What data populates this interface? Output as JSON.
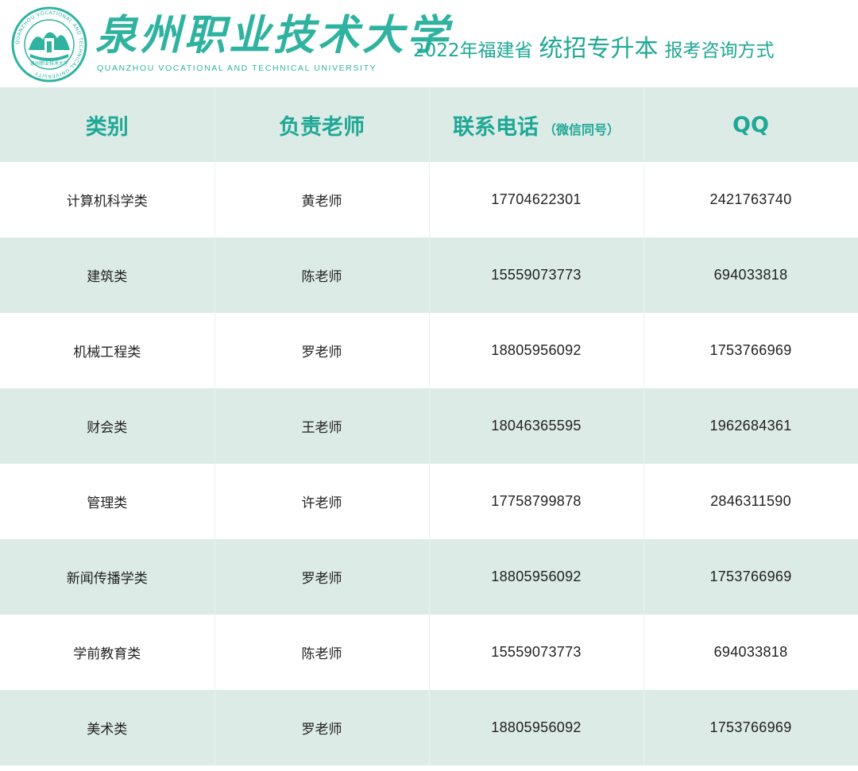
{
  "header": {
    "school_name_cn": "泉州职业技术大学",
    "school_name_en": "QUANZHOU VOCATIONAL AND TECHNICAL UNIVERSITY",
    "emblem_ring_text": "QUANZHOU VOCATIONAL AND TECHNICAL UNIVERSITY",
    "emblem_inner_text": "泉州职业技术大学",
    "headline_prefix": "2022年福建省",
    "headline_main": "统招专升本",
    "headline_suffix": "报考咨询方式"
  },
  "table": {
    "columns": {
      "category": "类别",
      "teacher": "负责老师",
      "phone": "联系电话",
      "phone_note": "（微信同号）",
      "qq": "QQ"
    },
    "rows": [
      {
        "category": "计算机科学类",
        "teacher": "黄老师",
        "phone": "17704622301",
        "qq": "2421763740"
      },
      {
        "category": "建筑类",
        "teacher": "陈老师",
        "phone": "15559073773",
        "qq": "694033818"
      },
      {
        "category": "机械工程类",
        "teacher": "罗老师",
        "phone": "18805956092",
        "qq": "1753766969"
      },
      {
        "category": "财会类",
        "teacher": "王老师",
        "phone": "18046365595",
        "qq": "1962684361"
      },
      {
        "category": "管理类",
        "teacher": "许老师",
        "phone": "17758799878",
        "qq": "2846311590"
      },
      {
        "category": "新闻传播学类",
        "teacher": "罗老师",
        "phone": "18805956092",
        "qq": "1753766969"
      },
      {
        "category": "学前教育类",
        "teacher": "陈老师",
        "phone": "15559073773",
        "qq": "694033818"
      },
      {
        "category": "美术类",
        "teacher": "罗老师",
        "phone": "18805956092",
        "qq": "1753766969"
      }
    ]
  },
  "colors": {
    "brand": "#2fb3a0",
    "header_row_bg": "#dcebe6",
    "stripe_bg": "#dcebe6"
  }
}
